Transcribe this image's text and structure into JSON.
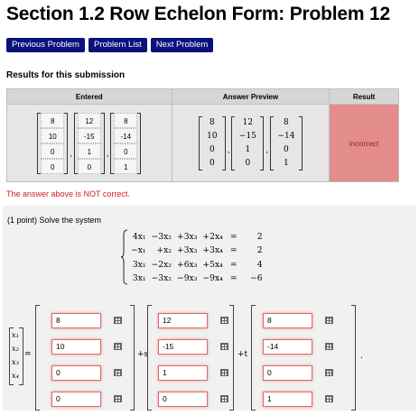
{
  "title": "Section 1.2 Row Echelon Form: Problem 12",
  "nav": {
    "previous": "Previous Problem",
    "list": "Problem List",
    "next": "Next Problem"
  },
  "results": {
    "heading": "Results for this submission",
    "columns": {
      "entered": "Entered",
      "preview": "Answer Preview",
      "result": "Result"
    },
    "entered": [
      [
        "8",
        "10",
        "0",
        "0"
      ],
      [
        "12",
        "-15",
        "1",
        "0"
      ],
      [
        "8",
        "-14",
        "0",
        "1"
      ]
    ],
    "preview": [
      [
        "8",
        "10",
        "0",
        "0"
      ],
      [
        "12",
        "−15",
        "1",
        "0"
      ],
      [
        "8",
        "−14",
        "0",
        "1"
      ]
    ],
    "separators": [
      ",",
      ","
    ],
    "result": "incorrect",
    "message": "The answer above is NOT correct."
  },
  "problem": {
    "text": "(1 point) Solve the system",
    "equations": [
      [
        "4x₁",
        "−3x₂",
        "+3x₃",
        "+2x₄",
        "=",
        "2"
      ],
      [
        "−x₁",
        "+x₂",
        "+3x₃",
        "+3x₄",
        "=",
        "2"
      ],
      [
        "3x₁",
        "−2x₂",
        "+6x₃",
        "+5x₄",
        "=",
        "4"
      ],
      [
        "3x₁",
        "−3x₂",
        "−9x₃",
        "−9x₄",
        "=",
        "−6"
      ]
    ]
  },
  "answer": {
    "variables": [
      "x₁",
      "x₂",
      "x₃",
      "x₄"
    ],
    "equals": "=",
    "plus_s": "+s",
    "plus_t": "+t",
    "period": ".",
    "vectors": [
      [
        "8",
        "10",
        "0",
        "0"
      ],
      [
        "12",
        "-15",
        "1",
        "0"
      ],
      [
        "8",
        "-14",
        "0",
        "1"
      ]
    ],
    "highlight_color": "#dd6a6a"
  },
  "colors": {
    "nav_button": "#09127a",
    "incorrect_bg": "#e28c8c",
    "error_text": "#cc2222"
  }
}
